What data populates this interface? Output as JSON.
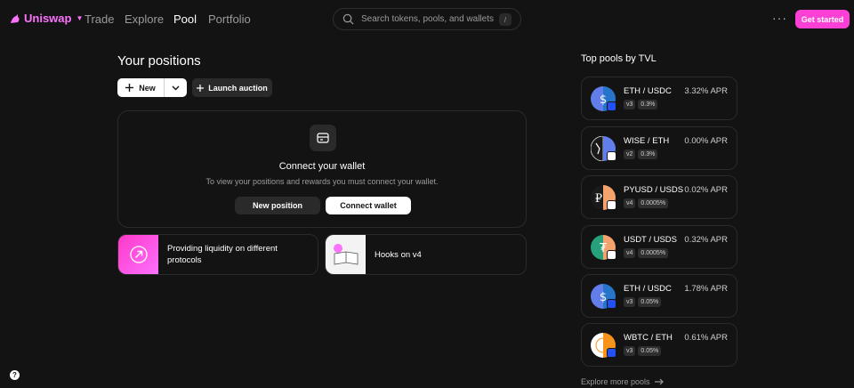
{
  "nav": {
    "brand": "Uniswap",
    "links": [
      "Trade",
      "Explore",
      "Pool",
      "Portfolio"
    ],
    "active": "Pool",
    "search_placeholder": "Search tokens, pools, and wallets",
    "search_shortcut": "/",
    "more": "···",
    "get_started": "Get started"
  },
  "positions": {
    "title": "Your positions",
    "new_label": "New",
    "launch_label": "Launch auction",
    "connect_title": "Connect your wallet",
    "connect_desc": "To view your positions and rewards you must connect your wallet.",
    "new_position": "New position",
    "connect_wallet": "Connect wallet"
  },
  "learn": [
    {
      "text": "Providing liquidity on different protocols"
    },
    {
      "text": "Hooks on v4"
    }
  ],
  "pools": {
    "title": "Top pools by TVL",
    "items": [
      {
        "pair": "ETH / USDC",
        "apr": "3.32% APR",
        "version": "v3",
        "fee": "0.3%",
        "color": "#627eea",
        "chain": "#2151f5"
      },
      {
        "pair": "WISE / ETH",
        "apr": "0.00% APR",
        "version": "v2",
        "fee": "0.3%",
        "color": "#e8e8e8",
        "chain": "#ffffff"
      },
      {
        "pair": "PYUSD / USDS",
        "apr": "0.02% APR",
        "version": "v4",
        "fee": "0.0005%",
        "color": "#f5a36c",
        "chain": "#ffffff"
      },
      {
        "pair": "USDT / USDS",
        "apr": "0.32% APR",
        "version": "v4",
        "fee": "0.0005%",
        "color": "#26a17b",
        "chain": "#ffffff"
      },
      {
        "pair": "ETH / USDC",
        "apr": "1.78% APR",
        "version": "v3",
        "fee": "0.05%",
        "color": "#627eea",
        "chain": "#2151f5"
      },
      {
        "pair": "WBTC / ETH",
        "apr": "0.61% APR",
        "version": "v3",
        "fee": "0.05%",
        "color": "#f7931a",
        "chain": "#2151f5"
      }
    ],
    "explore_more": "Explore more pools"
  },
  "help": "?",
  "colors": {
    "accent": "#fc72ff",
    "cta": "#fc40d6",
    "background": "#131313"
  }
}
